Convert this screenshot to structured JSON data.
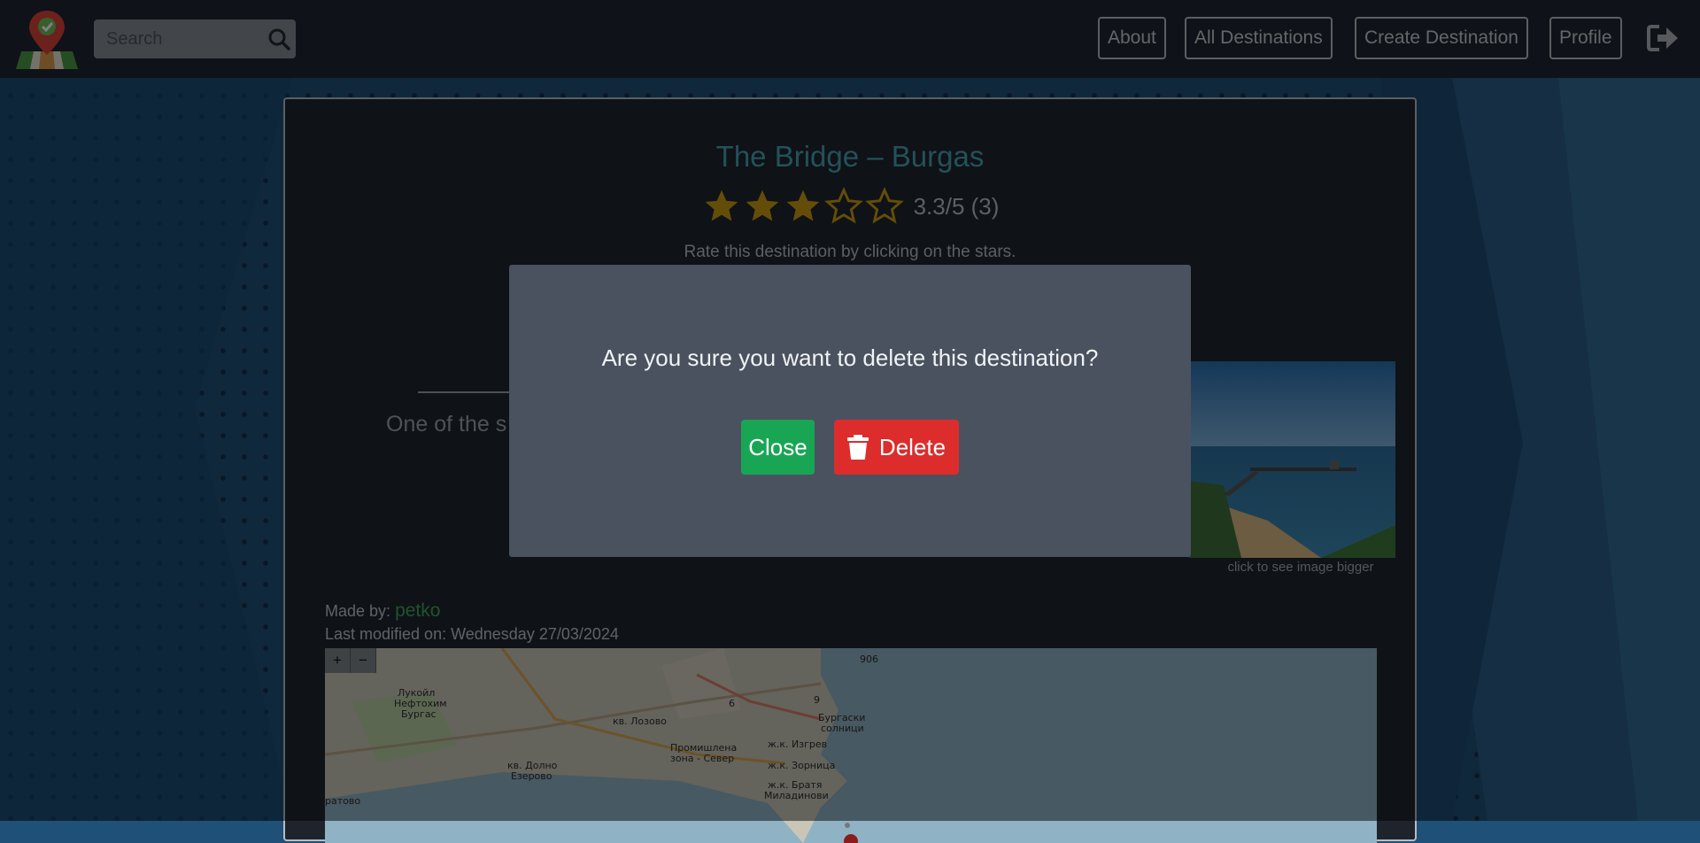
{
  "header": {
    "search_placeholder": "Search",
    "nav": {
      "about": "About",
      "all_destinations": "All Destinations",
      "create_destination": "Create Destination",
      "profile": "Profile"
    }
  },
  "destination": {
    "title": "The Bridge – Burgas",
    "rating": 3.3,
    "rating_text": "3.3/5 (3)",
    "stars_filled": 3,
    "stars_total": 5,
    "rate_hint": "Rate this destination by clicking on the stars.",
    "description_visible": "One of the s",
    "image_caption": "click to see image bigger",
    "made_by_label": "Made by:",
    "author": "petko",
    "last_modified": "Last modified on: Wednesday 27/03/2024"
  },
  "map": {
    "zoom_in": "+",
    "zoom_out": "−",
    "labels": [
      "906",
      "Лукойл",
      "Нефтохим",
      "Бургас",
      "кв. Лозово",
      "Бургаски",
      "солници",
      "Промишлена",
      "зона - Север",
      "ж.к. Изгрев",
      "кв. Долно",
      "Езерово",
      "ж.к. Зорница",
      "ж.к. Братя",
      "Миладинови",
      "ратово",
      "9",
      "6"
    ]
  },
  "modal": {
    "question": "Are you sure you want to delete this destination?",
    "close_label": "Close",
    "delete_label": "Delete"
  },
  "colors": {
    "accent_title": "#47a3b3",
    "star": "#c79a12",
    "close_green": "#19a654",
    "delete_red": "#dd2c2c",
    "author_green": "#3fa65c"
  },
  "icons": [
    "map-pin-logo-icon",
    "search-icon",
    "logout-icon",
    "star-icon",
    "trash-icon"
  ]
}
